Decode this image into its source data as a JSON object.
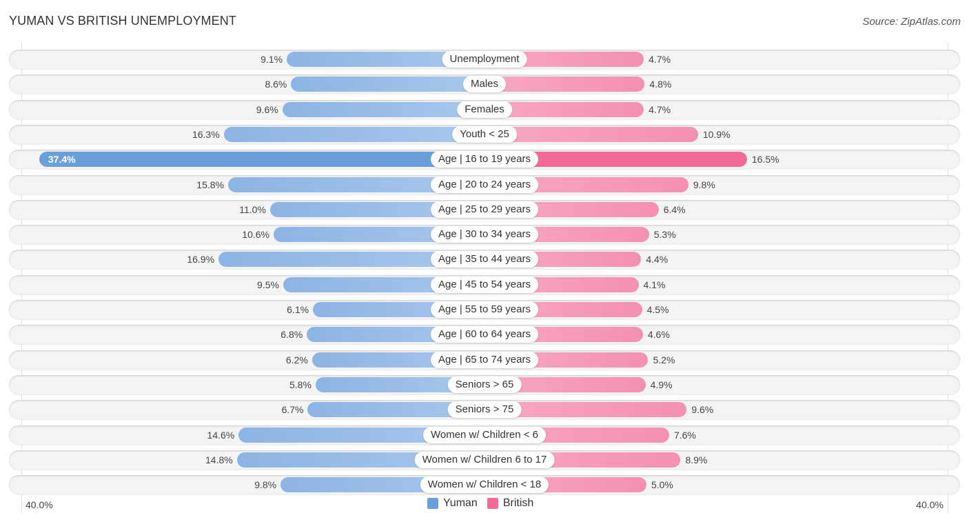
{
  "header": {
    "title": "YUMAN VS BRITISH UNEMPLOYMENT",
    "source": "Source: ZipAtlas.com"
  },
  "colors": {
    "yuman": "#6a9fdc",
    "british": "#f26b97"
  },
  "chart_data": {
    "type": "bar",
    "orientation": "horizontal-diverging",
    "title": "YUMAN VS BRITISH UNEMPLOYMENT",
    "xlabel": "",
    "ylabel": "",
    "xlim": [
      -40,
      40
    ],
    "axis_labels": {
      "left": "40.0%",
      "right": "40.0%"
    },
    "legend": {
      "position": "bottom-center",
      "entries": [
        "Yuman",
        "British"
      ]
    },
    "categories": [
      "Unemployment",
      "Males",
      "Females",
      "Youth < 25",
      "Age | 16 to 19 years",
      "Age | 20 to 24 years",
      "Age | 25 to 29 years",
      "Age | 30 to 34 years",
      "Age | 35 to 44 years",
      "Age | 45 to 54 years",
      "Age | 55 to 59 years",
      "Age | 60 to 64 years",
      "Age | 65 to 74 years",
      "Seniors > 65",
      "Seniors > 75",
      "Women w/ Children < 6",
      "Women w/ Children 6 to 17",
      "Women w/ Children < 18"
    ],
    "series": [
      {
        "name": "Yuman",
        "side": "left",
        "values": [
          9.1,
          8.6,
          9.6,
          16.3,
          37.4,
          15.8,
          11.0,
          10.6,
          16.9,
          9.5,
          6.1,
          6.8,
          6.2,
          5.8,
          6.7,
          14.6,
          14.8,
          9.8
        ],
        "labels": [
          "9.1%",
          "8.6%",
          "9.6%",
          "16.3%",
          "37.4%",
          "15.8%",
          "11.0%",
          "10.6%",
          "16.9%",
          "9.5%",
          "6.1%",
          "6.8%",
          "6.2%",
          "5.8%",
          "6.7%",
          "14.6%",
          "14.8%",
          "9.8%"
        ]
      },
      {
        "name": "British",
        "side": "right",
        "values": [
          4.7,
          4.8,
          4.7,
          10.9,
          16.5,
          9.8,
          6.4,
          5.3,
          4.4,
          4.1,
          4.5,
          4.6,
          5.2,
          4.9,
          9.6,
          7.6,
          8.9,
          5.0
        ],
        "labels": [
          "4.7%",
          "4.8%",
          "4.7%",
          "10.9%",
          "16.5%",
          "9.8%",
          "6.4%",
          "5.3%",
          "4.4%",
          "4.1%",
          "4.5%",
          "4.6%",
          "5.2%",
          "4.9%",
          "9.6%",
          "7.6%",
          "8.9%",
          "5.0%"
        ]
      }
    ]
  }
}
